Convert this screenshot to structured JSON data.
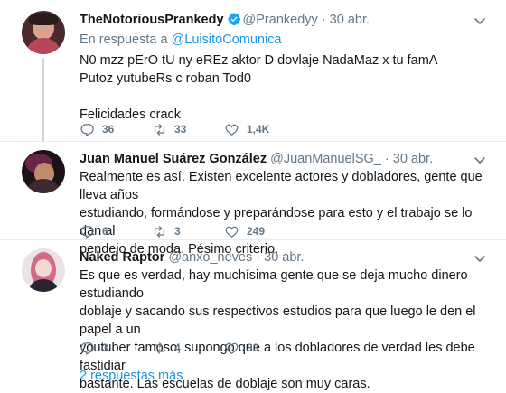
{
  "tweets": [
    {
      "name": "TheNotoriousPrankedy",
      "verified": true,
      "handle": "@Prankedyy",
      "dot": "·",
      "time": "30 abr.",
      "reply_prefix": "En respuesta a",
      "reply_to": "@LuisitoComunica",
      "lines": [
        "N0 mzz pErO tU ny eREz aktor D dovlaje NadaMaz x tu famA",
        "Putoz yutubeRs c roban Tod0",
        "",
        "Felicidades crack"
      ],
      "replies": "36",
      "retweets": "33",
      "likes": "1,4K"
    },
    {
      "name": "Juan Manuel Suárez González",
      "handle": "@JuanManuelSG_",
      "dot": "·",
      "time": "30 abr.",
      "lines": [
        "Realmente es así. Existen excelente actores y dobladores, gente que lleva años",
        "estudiando, formándose y preparándose para esto y el trabajo se lo dan al",
        "pendejo de moda. Pésimo criterio."
      ],
      "replies": "6",
      "retweets": "3",
      "likes": "249"
    },
    {
      "name": "Naked Raptor",
      "handle": "@anxo_neves",
      "dot": "·",
      "time": "30 abr.",
      "lines": [
        "Es que es verdad, hay muchísima gente que se deja mucho dinero estudiando",
        "doblaje y sacando sus respectivos estudios para que luego le den el papel a un",
        "youtuber famoso, supongo que a los dobladores de verdad les debe fastidiar",
        "bastante. Las escuelas de doblaje son muy caras."
      ],
      "replies": "3",
      "retweets": "4",
      "likes": "83"
    }
  ],
  "more_replies": "2 respuestas más",
  "colors": {
    "accent": "#1b95e0",
    "muted": "#657786",
    "text": "#14171a",
    "border": "#e6ecf0"
  },
  "icons": [
    "verified-badge-icon",
    "caret-down-icon",
    "reply-icon",
    "retweet-icon",
    "like-icon"
  ]
}
